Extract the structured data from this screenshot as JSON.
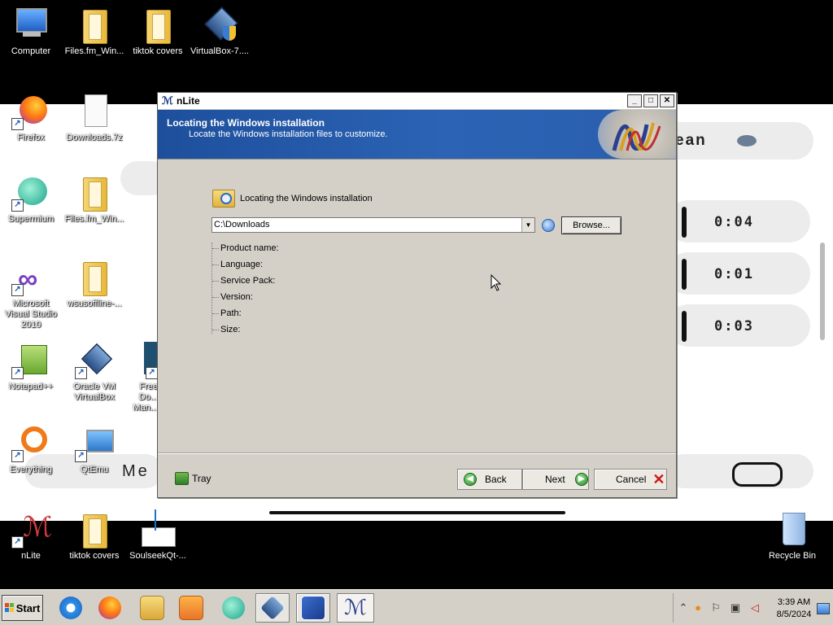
{
  "desktop": {
    "icons": [
      {
        "label": "Computer"
      },
      {
        "label": "Files.fm_Win..."
      },
      {
        "label": "tiktok covers"
      },
      {
        "label": "VirtualBox-7...."
      },
      {
        "label": "Firefox"
      },
      {
        "label": "Downloads.7z"
      },
      {
        "label": "Supermium"
      },
      {
        "label": "Files.fm_Win..."
      },
      {
        "label": "Microsoft Visual Studio 2010"
      },
      {
        "label": "wsusoffline-..."
      },
      {
        "label": "Notepad++"
      },
      {
        "label": "Oracle VM VirtualBox"
      },
      {
        "label": "Free Do... Man..."
      },
      {
        "label": "Everything"
      },
      {
        "label": "QtEmu"
      },
      {
        "label": "nLite"
      },
      {
        "label": "tiktok covers"
      },
      {
        "label": "SoulseekQt-..."
      },
      {
        "label": "Recycle Bin"
      }
    ],
    "wallpaper_timers": [
      "0:04",
      "0:01",
      "0:03"
    ],
    "wallpaper_text": [
      "ean",
      "Me"
    ]
  },
  "window": {
    "title": "nLite",
    "controls": {
      "minimize": "_",
      "maximize": "□",
      "close": "✕"
    },
    "banner_title": "Locating the Windows installation",
    "banner_subtitle": "Locate the Windows installation files to customize.",
    "section_title": "Locating the Windows installation",
    "path_value": "C:\\Downloads",
    "browse_label": "Browse...",
    "details": [
      "Product name:",
      "Language:",
      "Service Pack:",
      "Version:",
      "Path:",
      "Size:"
    ],
    "tray_label": "Tray",
    "back_label": "Back",
    "next_label": "Next",
    "cancel_label": "Cancel"
  },
  "taskbar": {
    "start_label": "Start",
    "apps": [
      "internet-explorer",
      "firefox",
      "explorer",
      "media-player",
      "supermium",
      "virtualbox",
      "windows-xp-vm",
      "nlite"
    ],
    "active_app": "nlite",
    "time": "3:39 AM",
    "date": "8/5/2024"
  },
  "colors": {
    "banner": "#2c63b4",
    "window_face": "#d4d0c8",
    "next_green": "#2e8b2e",
    "cancel_red": "#d01818"
  }
}
